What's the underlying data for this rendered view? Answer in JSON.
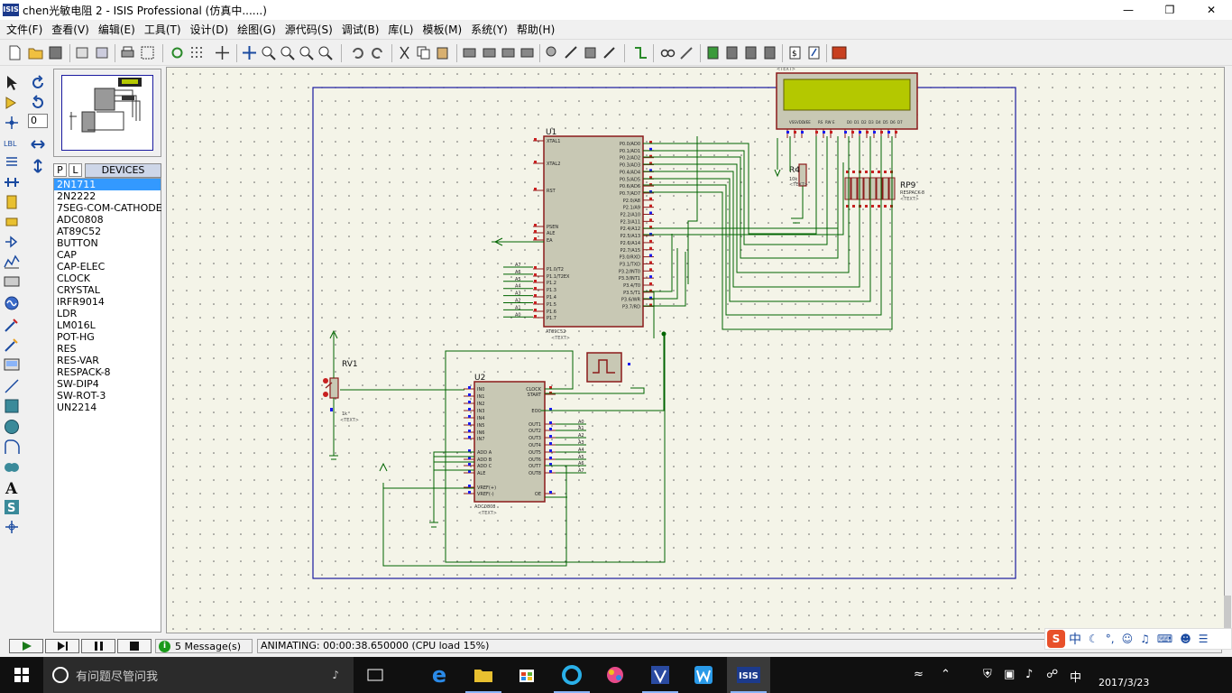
{
  "window": {
    "title": "chen光敏电阻 2 - ISIS Professional (仿真中......)",
    "app_icon_text": "ISIS"
  },
  "menu": [
    "文件(F)",
    "查看(V)",
    "编辑(E)",
    "工具(T)",
    "设计(D)",
    "绘图(G)",
    "源代码(S)",
    "调试(B)",
    "库(L)",
    "模板(M)",
    "系统(Y)",
    "帮助(H)"
  ],
  "sidebar": {
    "rotation_value": "0",
    "pick_button": "P",
    "library_button": "L",
    "devices_label": "DEVICES",
    "devices": [
      "2N1711",
      "2N2222",
      "7SEG-COM-CATHODE",
      "ADC0808",
      "AT89C52",
      "BUTTON",
      "CAP",
      "CAP-ELEC",
      "CLOCK",
      "CRYSTAL",
      "IRFR9014",
      "LDR",
      "LM016L",
      "POT-HG",
      "RES",
      "RES-VAR",
      "RESPACK-8",
      "SW-DIP4",
      "SW-ROT-3",
      "UN2214"
    ],
    "selected_device": "2N1711"
  },
  "schematic": {
    "u1_ref": "U1",
    "u1_part": "AT89C52",
    "u1_left_pins": [
      "XTAL1",
      "XTAL2",
      "RST",
      "PSEN",
      "ALE",
      "EA",
      "P1.0/T2",
      "P1.1/T2EX",
      "P1.2",
      "P1.3",
      "P1.4",
      "P1.5",
      "P1.6",
      "P1.7"
    ],
    "u1_right_pins": [
      "P0.0/AD0",
      "P0.1/AD1",
      "P0.2/AD2",
      "P0.3/AD3",
      "P0.4/AD4",
      "P0.5/AD5",
      "P0.6/AD6",
      "P0.7/AD7",
      "P2.0/A8",
      "P2.1/A9",
      "P2.2/A10",
      "P2.3/A11",
      "P2.4/A12",
      "P2.5/A13",
      "P2.6/A14",
      "P2.7/A15",
      "P3.0/RXD",
      "P3.1/TXD",
      "P3.2/INT0",
      "P3.3/INT1",
      "P3.4/T0",
      "P3.5/T1",
      "P3.6/WR",
      "P3.7/RD"
    ],
    "u2_ref": "U2",
    "u2_part": "ADC0808",
    "u2_left_pins": [
      "IN0",
      "IN1",
      "IN2",
      "IN3",
      "IN4",
      "IN5",
      "IN6",
      "IN7",
      "ADD A",
      "ADD B",
      "ADD C",
      "ALE",
      "VREF(+)",
      "VREF(-)"
    ],
    "u2_right_pins": [
      "CLOCK",
      "START",
      "EOC",
      "OUT1",
      "OUT2",
      "OUT3",
      "OUT4",
      "OUT5",
      "OUT6",
      "OUT7",
      "OUT8",
      "OE"
    ],
    "rv1_ref": "RV1",
    "rv1_value": "1k",
    "r4_ref": "R4",
    "r4_value": "10k",
    "rp_ref": "RP9",
    "rp_part": "RESPACK-8",
    "text_placeholder": "<TEXT>"
  },
  "status": {
    "messages": "5 Message(s)",
    "animating": "ANIMATING: 00:00:38.650000 (CPU load 15%)"
  },
  "taskbar": {
    "search_placeholder": "有问题尽管问我",
    "ime_label": "中",
    "clock_date": "2017/3/23"
  },
  "ime": {
    "lang": "中"
  },
  "colors": {
    "canvas_bg": "#f4f4e8",
    "wire": "#006400",
    "component_outline": "#8b1a1a",
    "component_fill": "#c8c8b4",
    "sheet_border": "#1a1aa0",
    "lcd_screen": "#b4c800"
  }
}
